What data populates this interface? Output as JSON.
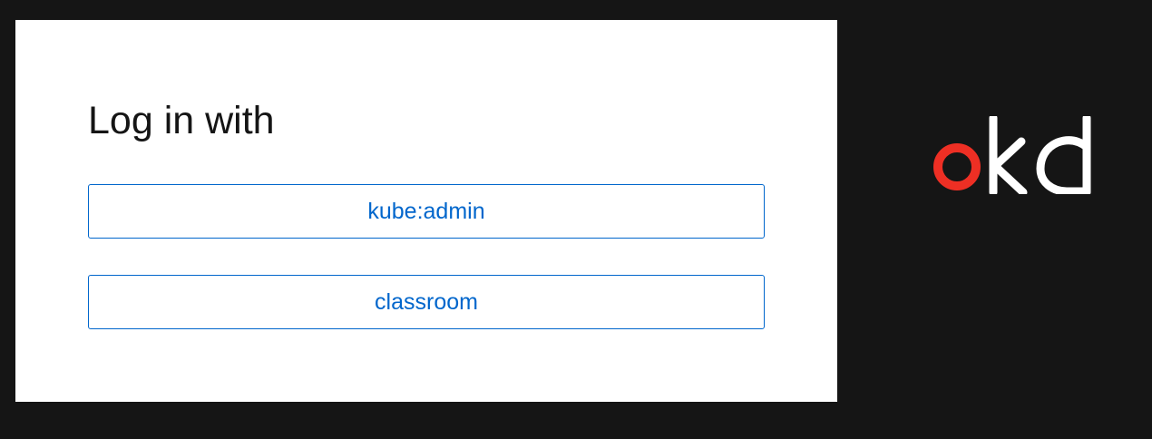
{
  "login": {
    "title": "Log in with",
    "providers": [
      {
        "label": "kube:admin"
      },
      {
        "label": "classroom"
      }
    ]
  },
  "brand": {
    "logo_text": "okd",
    "colors": {
      "o": "#ee2f24",
      "kd": "#ffffff",
      "background": "#151515"
    }
  },
  "colors": {
    "accent": "#0066cc",
    "card_background": "#ffffff",
    "title_text": "#151515"
  }
}
